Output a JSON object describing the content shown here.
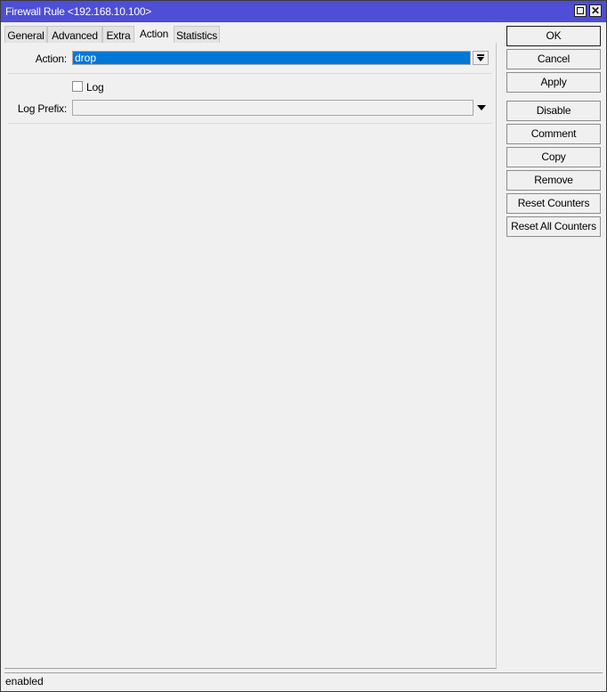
{
  "window": {
    "title": "Firewall Rule <192.168.10.100>",
    "maximize_icon": "maximize-icon",
    "close_icon": "close-icon",
    "close_glyph": "✕"
  },
  "tabs": [
    {
      "label": "General",
      "active": false
    },
    {
      "label": "Advanced",
      "active": false
    },
    {
      "label": "Extra",
      "active": false
    },
    {
      "label": "Action",
      "active": true
    },
    {
      "label": "Statistics",
      "active": false
    }
  ],
  "form": {
    "action": {
      "label": "Action:",
      "value": "drop"
    },
    "log": {
      "label": "Log",
      "checked": false
    },
    "log_prefix": {
      "label": "Log Prefix:",
      "value": ""
    }
  },
  "buttons": [
    {
      "label": "OK"
    },
    {
      "label": "Cancel"
    },
    {
      "label": "Apply"
    },
    {
      "label": "Disable"
    },
    {
      "label": "Comment"
    },
    {
      "label": "Copy"
    },
    {
      "label": "Remove"
    },
    {
      "label": "Reset Counters"
    },
    {
      "label": "Reset All Counters"
    }
  ],
  "status": {
    "text": "enabled"
  },
  "colors": {
    "titlebar": "#4e4ed6",
    "selection": "#0078d7",
    "background": "#f0f0f0"
  }
}
